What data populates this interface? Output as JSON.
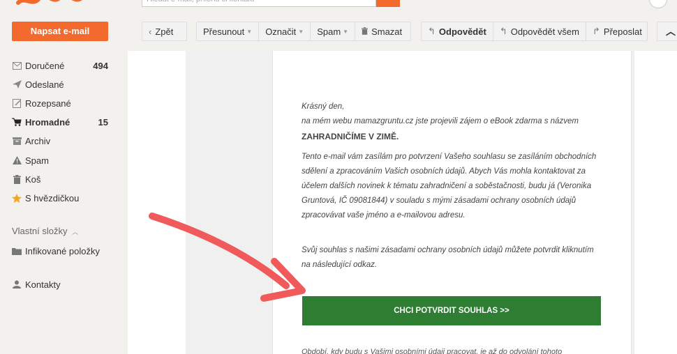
{
  "brand": {
    "accent": "#f36a2e",
    "cta_color": "#2e7d32",
    "arrow_color": "#f05a5a"
  },
  "search": {
    "placeholder": "Hledat e-mail, přílohu či kontakt"
  },
  "sidebar": {
    "compose_label": "Napsat e-mail",
    "folders": [
      {
        "label": "Doručené",
        "count": "494",
        "icon": "inbox-icon"
      },
      {
        "label": "Odeslané",
        "count": "",
        "icon": "send-icon"
      },
      {
        "label": "Rozepsané",
        "count": "",
        "icon": "draft-icon"
      },
      {
        "label": "Hromadné",
        "count": "15",
        "icon": "cart-icon"
      },
      {
        "label": "Archiv",
        "count": "",
        "icon": "archive-icon"
      },
      {
        "label": "Spam",
        "count": "",
        "icon": "warning-icon"
      },
      {
        "label": "Koš",
        "count": "",
        "icon": "trash-icon"
      },
      {
        "label": "S hvězdičkou",
        "count": "",
        "icon": "star-icon"
      }
    ],
    "custom_title": "Vlastní složky",
    "custom_folder": "Infikované položky",
    "contacts": "Kontakty"
  },
  "toolbar": {
    "back": "Zpět",
    "move": "Přesunout",
    "mark": "Označit",
    "spam": "Spam",
    "delete": "Smazat",
    "reply": "Odpovědět",
    "reply_all": "Odpovědět všem",
    "forward": "Přeposlat"
  },
  "email": {
    "greeting": "Krásný den,",
    "line1": "na mém webu mamazgruntu.cz jste projevili zájem o eBook zdarma s názvem",
    "book_title": "ZAHRADNIČÍME V ZIMĚ.",
    "para1": "Tento e-mail vám zasílám pro potvrzení Vašeho souhlasu se zasíláním obchodních sdělení a zpracováním Vašich osobních údajů. Abych Vás mohla kontaktovat za účelem dalších novinek k tématu zahradničení a soběstačnosti, budu já (Veronika Gruntová, IČ 09081844) v souladu s mými zásadami ochrany osobních údajů zpracovávat vaše jméno a e-mailovou adresu.",
    "para2": "Svůj souhlas s našimi zásadami ochrany osobních údajů můžete potvrdit kliknutím na následující odkaz.",
    "cta": "CHCI POTVRDIT SOUHLAS >>",
    "footer": "Období, kdy budu s Vašimi osobními údaji pracovat, je až do odvolání tohoto souhlasu."
  }
}
